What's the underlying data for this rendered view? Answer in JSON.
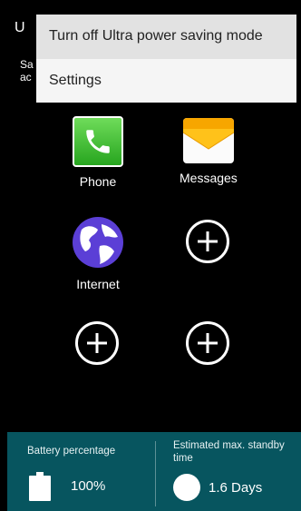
{
  "background": {
    "title_fragment": "U",
    "desc_line1": "Sa",
    "desc_line2": "ac"
  },
  "menu": {
    "items": [
      {
        "label": "Turn off Ultra power saving mode"
      },
      {
        "label": "Settings"
      }
    ]
  },
  "apps": [
    {
      "label": "Phone",
      "icon": "phone-icon"
    },
    {
      "label": "Messages",
      "icon": "messages-icon"
    },
    {
      "label": "Internet",
      "icon": "globe-icon"
    },
    {
      "label": "",
      "icon": "add-icon"
    },
    {
      "label": "",
      "icon": "add-icon"
    },
    {
      "label": "",
      "icon": "add-icon"
    }
  ],
  "status": {
    "battery_label": "Battery percentage",
    "battery_value": "100%",
    "standby_label": "Estimated max. standby time",
    "standby_value": "1.6 Days",
    "bar_color": "#07555f"
  }
}
